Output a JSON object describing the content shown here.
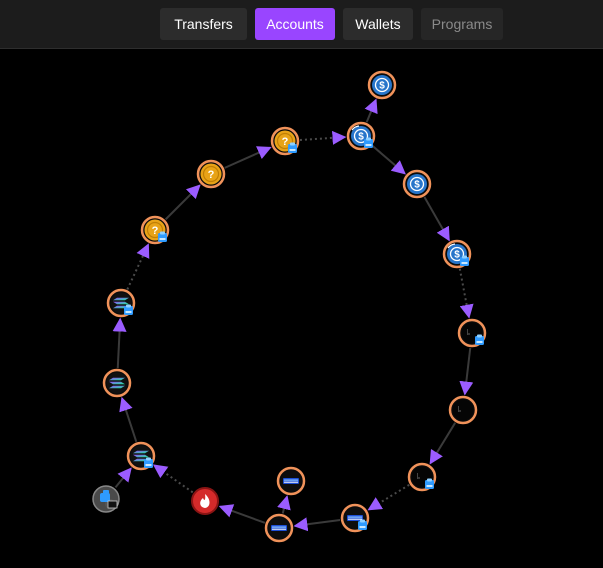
{
  "tabs": [
    {
      "label": "Transfers",
      "state": "default"
    },
    {
      "label": "Accounts",
      "state": "active"
    },
    {
      "label": "Wallets",
      "state": "default"
    },
    {
      "label": "Programs",
      "state": "disabled"
    }
  ],
  "colors": {
    "accent": "#9945ff",
    "node_ring": "#f0925a",
    "edge": "#3a3a3a",
    "arrow": "#9b5cff",
    "usdc": "#2775ca",
    "unknown_token": "#e8a317",
    "sol_gradient": [
      "#9945ff",
      "#14f195"
    ],
    "burn": "#d42a2a",
    "wallet_badge": "#2f9bff"
  },
  "graph": {
    "nodes": [
      {
        "id": "usdc-top",
        "icon": "usdc-icon",
        "badge": false
      },
      {
        "id": "usdc-swap-1",
        "icon": "usdc-swap-icon",
        "badge": true
      },
      {
        "id": "usdc-2",
        "icon": "usdc-icon",
        "badge": false
      },
      {
        "id": "usdc-swap-2",
        "icon": "usdc-swap-icon",
        "badge": true
      },
      {
        "id": "dark-token-1",
        "icon": "dark-token-icon",
        "badge": true
      },
      {
        "id": "dark-token-2",
        "icon": "dark-token-icon",
        "badge": false
      },
      {
        "id": "dark-token-3",
        "icon": "dark-token-icon",
        "badge": true
      },
      {
        "id": "tnsr-1",
        "icon": "tnsr-icon",
        "badge": true
      },
      {
        "id": "tnsr-2",
        "icon": "tnsr-icon",
        "badge": false
      },
      {
        "id": "tnsr-3",
        "icon": "tnsr-icon",
        "badge": false
      },
      {
        "id": "burn",
        "icon": "fire-icon",
        "badge": false
      },
      {
        "id": "sol-1",
        "icon": "solana-icon",
        "badge": true
      },
      {
        "id": "wallet",
        "icon": "wallet-icon",
        "badge": false
      },
      {
        "id": "sol-2",
        "icon": "solana-icon",
        "badge": false
      },
      {
        "id": "sol-3",
        "icon": "solana-icon",
        "badge": true
      },
      {
        "id": "unknown-1",
        "icon": "unknown-token-icon",
        "badge": true
      },
      {
        "id": "unknown-2",
        "icon": "unknown-token-icon",
        "badge": false
      },
      {
        "id": "unknown-3",
        "icon": "unknown-token-icon",
        "badge": true
      }
    ],
    "edges": [
      {
        "from": "usdc-swap-1",
        "to": "usdc-top",
        "style": "solid"
      },
      {
        "from": "usdc-swap-1",
        "to": "usdc-2",
        "style": "solid"
      },
      {
        "from": "usdc-2",
        "to": "usdc-swap-2",
        "style": "solid"
      },
      {
        "from": "usdc-swap-2",
        "to": "dark-token-1",
        "style": "dotted"
      },
      {
        "from": "dark-token-1",
        "to": "dark-token-2",
        "style": "solid"
      },
      {
        "from": "dark-token-2",
        "to": "dark-token-3",
        "style": "solid"
      },
      {
        "from": "dark-token-3",
        "to": "tnsr-1",
        "style": "dotted"
      },
      {
        "from": "tnsr-1",
        "to": "tnsr-2",
        "style": "solid"
      },
      {
        "from": "tnsr-2",
        "to": "tnsr-3",
        "style": "solid"
      },
      {
        "from": "tnsr-2",
        "to": "burn",
        "style": "solid"
      },
      {
        "from": "burn",
        "to": "sol-1",
        "style": "dotted"
      },
      {
        "from": "wallet",
        "to": "sol-1",
        "style": "solid"
      },
      {
        "from": "sol-1",
        "to": "sol-2",
        "style": "solid"
      },
      {
        "from": "sol-2",
        "to": "sol-3",
        "style": "solid"
      },
      {
        "from": "sol-3",
        "to": "unknown-1",
        "style": "dotted"
      },
      {
        "from": "unknown-1",
        "to": "unknown-2",
        "style": "solid"
      },
      {
        "from": "unknown-2",
        "to": "unknown-3",
        "style": "solid"
      },
      {
        "from": "unknown-3",
        "to": "usdc-swap-1",
        "style": "dotted"
      }
    ]
  }
}
